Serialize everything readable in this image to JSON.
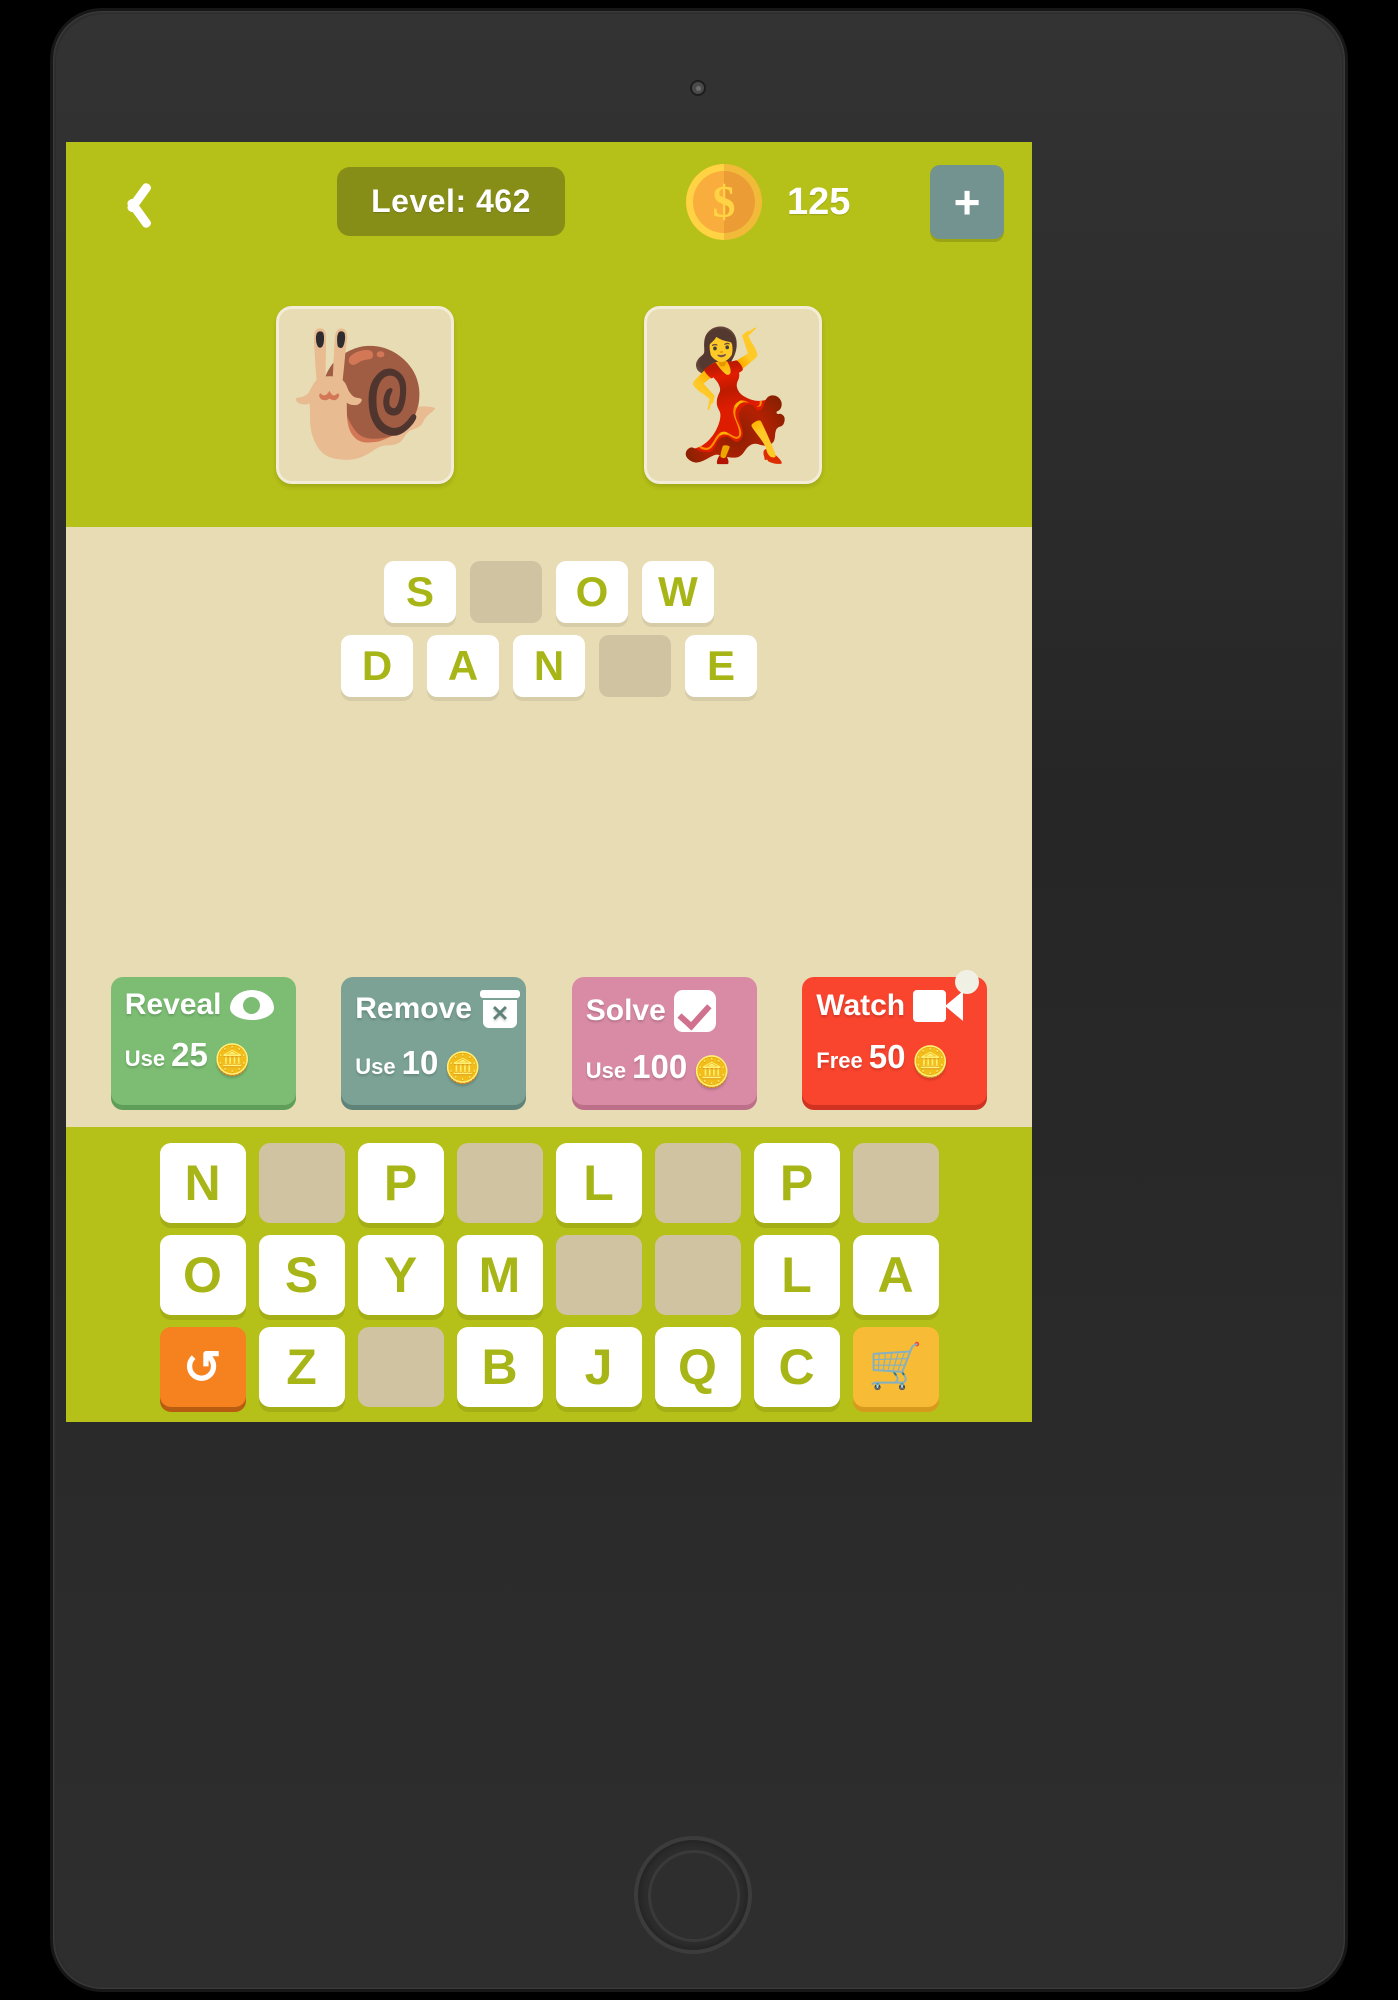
{
  "header": {
    "back_icon": "back-chevron-icon",
    "level_label": "Level: 462",
    "coin_icon": "coin-dollar-icon",
    "coin_symbol": "$",
    "coin_count": "125",
    "add_coins_label": "+"
  },
  "puzzle": {
    "clues": [
      {
        "name": "clue-snail",
        "emoji": "🐌"
      },
      {
        "name": "clue-dancer",
        "emoji": "💃"
      }
    ]
  },
  "answer": {
    "rows": [
      {
        "tiles": [
          "S",
          "",
          "O",
          "W"
        ]
      },
      {
        "tiles": [
          "D",
          "A",
          "N",
          "",
          "E"
        ]
      }
    ]
  },
  "powerups": [
    {
      "name": "reveal",
      "label": "Reveal",
      "icon": "eye-icon",
      "cost_prefix": "Use",
      "cost": "25",
      "coins_emoji": "🪙",
      "color": "#7cbd73"
    },
    {
      "name": "remove",
      "label": "Remove",
      "icon": "trash-x-icon",
      "cost_prefix": "Use",
      "cost": "10",
      "coins_emoji": "🪙",
      "color": "#7ba295"
    },
    {
      "name": "solve",
      "label": "Solve",
      "icon": "checkbox-check-icon",
      "cost_prefix": "Use",
      "cost": "100",
      "coins_emoji": "🪙",
      "color": "#d98ba5"
    },
    {
      "name": "watch",
      "label": "Watch",
      "icon": "video-camera-icon",
      "cost_prefix": "Free",
      "cost": "50",
      "coins_emoji": "🪙",
      "color": "#f9442e"
    }
  ],
  "keyboard": {
    "rows": [
      [
        "N",
        "",
        "P",
        "",
        "L",
        "",
        "P",
        ""
      ],
      [
        "O",
        "S",
        "Y",
        "M",
        "",
        "",
        "L",
        "A"
      ],
      [
        "refresh",
        "Z",
        "",
        "B",
        "J",
        "Q",
        "C",
        "cart"
      ]
    ],
    "refresh_icon": "refresh-icon",
    "refresh_glyph": "↻",
    "cart_icon": "shopping-cart-icon",
    "cart_glyph": "🛒"
  },
  "colors": {
    "brand_green": "#b5c018",
    "board_beige": "#e8dcb5",
    "tile_empty": "#cfc3a1",
    "letter_green": "#a8b517",
    "level_pill": "#878e18",
    "plus_teal": "#72938f"
  }
}
